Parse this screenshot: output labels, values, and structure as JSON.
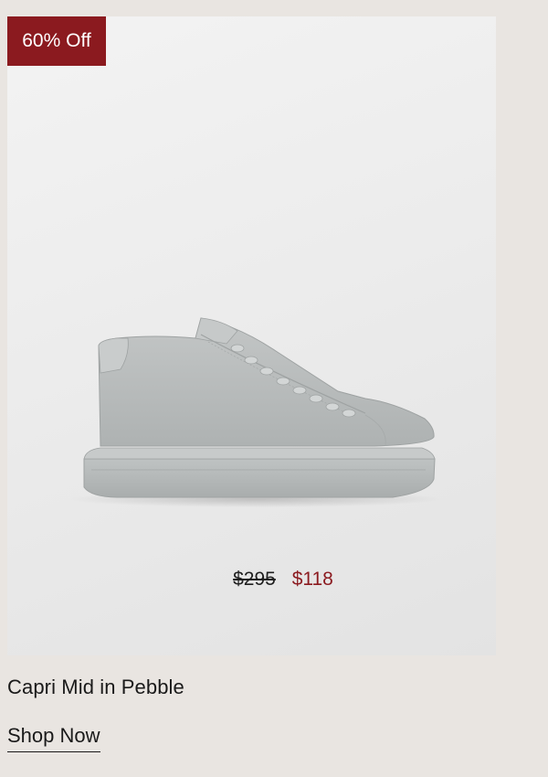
{
  "product": {
    "discount_badge": "60% Off",
    "original_price": "$295",
    "sale_price": "$118",
    "name": "Capri Mid in Pebble",
    "cta_label": "Shop Now",
    "image_icon": "sneaker-image",
    "colors": {
      "badge": "#8b1a1f",
      "sale_price": "#8b1a1f",
      "page_background": "#e9e5e1",
      "card_background": "#ececec",
      "shoe": "#b7bbbb"
    }
  }
}
